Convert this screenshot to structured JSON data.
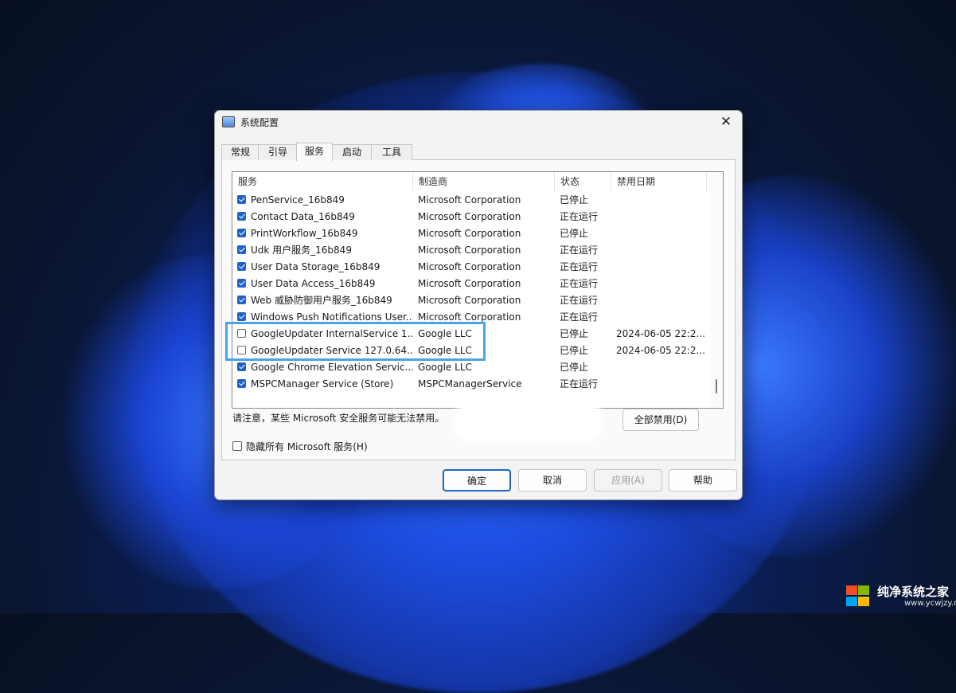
{
  "window": {
    "title": "系统配置",
    "close_glyph": "✕"
  },
  "tabs": [
    {
      "label": "常规",
      "active": false
    },
    {
      "label": "引导",
      "active": false
    },
    {
      "label": "服务",
      "active": true
    },
    {
      "label": "启动",
      "active": false
    },
    {
      "label": "工具",
      "active": false
    }
  ],
  "columns": [
    "服务",
    "制造商",
    "状态",
    "禁用日期"
  ],
  "rows": [
    {
      "checked": true,
      "name": "PenService_16b849",
      "maker": "Microsoft Corporation",
      "status": "已停止",
      "date": ""
    },
    {
      "checked": true,
      "name": "Contact Data_16b849",
      "maker": "Microsoft Corporation",
      "status": "正在运行",
      "date": ""
    },
    {
      "checked": true,
      "name": "PrintWorkflow_16b849",
      "maker": "Microsoft Corporation",
      "status": "已停止",
      "date": ""
    },
    {
      "checked": true,
      "name": "Udk 用户服务_16b849",
      "maker": "Microsoft Corporation",
      "status": "正在运行",
      "date": ""
    },
    {
      "checked": true,
      "name": "User Data Storage_16b849",
      "maker": "Microsoft Corporation",
      "status": "正在运行",
      "date": ""
    },
    {
      "checked": true,
      "name": "User Data Access_16b849",
      "maker": "Microsoft Corporation",
      "status": "正在运行",
      "date": ""
    },
    {
      "checked": true,
      "name": "Web 威胁防御用户服务_16b849",
      "maker": "Microsoft Corporation",
      "status": "正在运行",
      "date": ""
    },
    {
      "checked": true,
      "name": "Windows Push Notifications User...",
      "maker": "Microsoft Corporation",
      "status": "正在运行",
      "date": ""
    },
    {
      "checked": false,
      "name": "GoogleUpdater InternalService 1...",
      "maker": "Google LLC",
      "status": "已停止",
      "date": "2024-06-05 22:2..."
    },
    {
      "checked": false,
      "name": "GoogleUpdater Service 127.0.64...",
      "maker": "Google LLC",
      "status": "已停止",
      "date": "2024-06-05 22:2..."
    },
    {
      "checked": true,
      "name": "Google Chrome Elevation Servic...",
      "maker": "Google LLC",
      "status": "已停止",
      "date": ""
    },
    {
      "checked": true,
      "name": "MSPCManager Service (Store)",
      "maker": "MSPCManagerService",
      "status": "正在运行",
      "date": ""
    }
  ],
  "note": "请注意，某些 Microsoft 安全服务可能无法禁用。",
  "buttons": {
    "disable_all": "全部禁用(D)",
    "ok": "确定",
    "cancel": "取消",
    "apply": "应用(A)",
    "help": "帮助"
  },
  "hide_ms": {
    "label": "隐藏所有 Microsoft 服务(H)",
    "checked": false
  },
  "watermark": {
    "title": "纯净系统之家",
    "url": "www.ycwjzy.com"
  }
}
